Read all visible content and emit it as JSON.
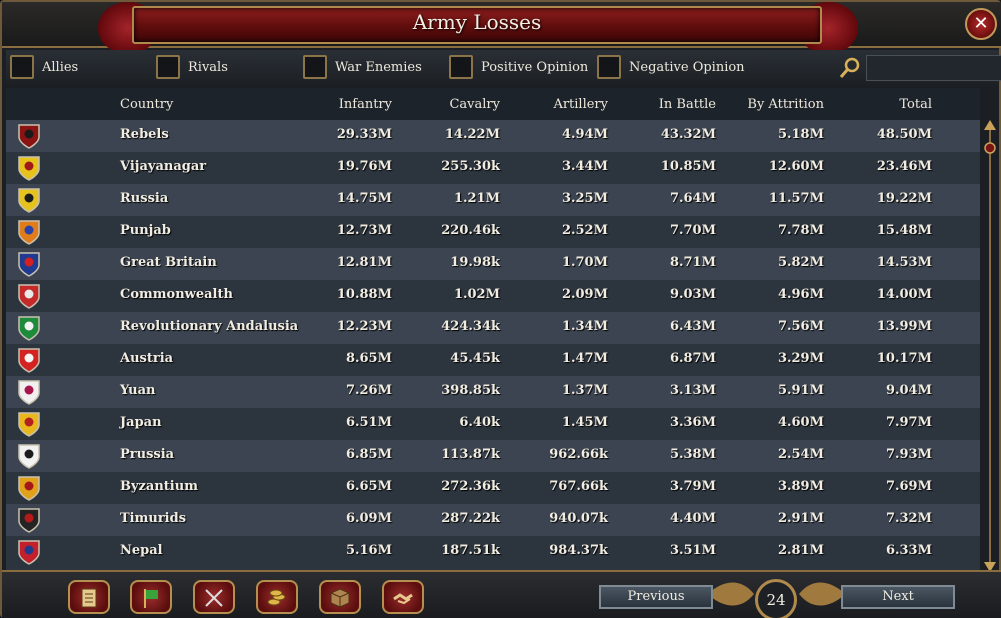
{
  "window": {
    "title": "Army Losses",
    "close_label": "✕"
  },
  "filters": [
    {
      "label": "Allies"
    },
    {
      "label": "Rivals"
    },
    {
      "label": "War Enemies"
    },
    {
      "label": "Positive Opinion"
    },
    {
      "label": "Negative Opinion"
    }
  ],
  "search": {
    "placeholder": "",
    "value": ""
  },
  "columns": [
    "Country",
    "Infantry",
    "Cavalry",
    "Artillery",
    "In Battle",
    "By Attrition",
    "Total"
  ],
  "rows": [
    {
      "country": "Rebels",
      "infantry": "29.33M",
      "cavalry": "14.22M",
      "artillery": "4.94M",
      "in_battle": "43.32M",
      "by_attrition": "5.18M",
      "total": "48.50M",
      "flag": [
        "#8a1414",
        "#1a1a1a"
      ]
    },
    {
      "country": "Vijayanagar",
      "infantry": "19.76M",
      "cavalry": "255.30k",
      "artillery": "3.44M",
      "in_battle": "10.85M",
      "by_attrition": "12.60M",
      "total": "23.46M",
      "flag": [
        "#e7c21b",
        "#a01818"
      ]
    },
    {
      "country": "Russia",
      "infantry": "14.75M",
      "cavalry": "1.21M",
      "artillery": "3.25M",
      "in_battle": "7.64M",
      "by_attrition": "11.57M",
      "total": "19.22M",
      "flag": [
        "#e6c21f",
        "#1b1b1b"
      ]
    },
    {
      "country": "Punjab",
      "infantry": "12.73M",
      "cavalry": "220.46k",
      "artillery": "2.52M",
      "in_battle": "7.70M",
      "by_attrition": "7.78M",
      "total": "15.48M",
      "flag": [
        "#e07d1a",
        "#2742a8"
      ]
    },
    {
      "country": "Great Britain",
      "infantry": "12.81M",
      "cavalry": "19.98k",
      "artillery": "1.70M",
      "in_battle": "8.71M",
      "by_attrition": "5.82M",
      "total": "14.53M",
      "flag": [
        "#1f3a8f",
        "#d52020"
      ]
    },
    {
      "country": "Commonwealth",
      "infantry": "10.88M",
      "cavalry": "1.02M",
      "artillery": "2.09M",
      "in_battle": "9.03M",
      "by_attrition": "4.96M",
      "total": "14.00M",
      "flag": [
        "#c42a2a",
        "#e9e9e9"
      ]
    },
    {
      "country": "Revolutionary Andalusia",
      "infantry": "12.23M",
      "cavalry": "424.34k",
      "artillery": "1.34M",
      "in_battle": "6.43M",
      "by_attrition": "7.56M",
      "total": "13.99M",
      "flag": [
        "#1e8a3b",
        "#f2f2f2"
      ]
    },
    {
      "country": "Austria",
      "infantry": "8.65M",
      "cavalry": "45.45k",
      "artillery": "1.47M",
      "in_battle": "6.87M",
      "by_attrition": "3.29M",
      "total": "10.17M",
      "flag": [
        "#d42222",
        "#f4f4f4"
      ]
    },
    {
      "country": "Yuan",
      "infantry": "7.26M",
      "cavalry": "398.85k",
      "artillery": "1.37M",
      "in_battle": "3.13M",
      "by_attrition": "5.91M",
      "total": "9.04M",
      "flag": [
        "#f0f0f0",
        "#a8154a"
      ]
    },
    {
      "country": "Japan",
      "infantry": "6.51M",
      "cavalry": "6.40k",
      "artillery": "1.45M",
      "in_battle": "3.36M",
      "by_attrition": "4.60M",
      "total": "7.97M",
      "flag": [
        "#e8b81e",
        "#b32020"
      ]
    },
    {
      "country": "Prussia",
      "infantry": "6.85M",
      "cavalry": "113.87k",
      "artillery": "962.66k",
      "in_battle": "5.38M",
      "by_attrition": "2.54M",
      "total": "7.93M",
      "flag": [
        "#f2f2f2",
        "#1c1c1c"
      ]
    },
    {
      "country": "Byzantium",
      "infantry": "6.65M",
      "cavalry": "272.36k",
      "artillery": "767.66k",
      "in_battle": "3.79M",
      "by_attrition": "3.89M",
      "total": "7.69M",
      "flag": [
        "#e0a21b",
        "#a61818"
      ]
    },
    {
      "country": "Timurids",
      "infantry": "6.09M",
      "cavalry": "287.22k",
      "artillery": "940.07k",
      "in_battle": "4.40M",
      "by_attrition": "2.91M",
      "total": "7.32M",
      "flag": [
        "#242424",
        "#b41a1a"
      ]
    },
    {
      "country": "Nepal",
      "infantry": "5.16M",
      "cavalry": "187.51k",
      "artillery": "984.37k",
      "in_battle": "3.51M",
      "by_attrition": "2.81M",
      "total": "6.33M",
      "flag": [
        "#c4202c",
        "#1f3b8c"
      ]
    }
  ],
  "bottom": {
    "icons": [
      "ledger-icon",
      "flag-icon",
      "crossed-swords-icon",
      "coins-icon",
      "crate-icon",
      "handshake-icon"
    ],
    "previous_label": "Previous",
    "next_label": "Next",
    "page_number": "24"
  },
  "colors": {
    "accent_red": "#7a1414",
    "gold_trim": "#b08a4c",
    "row_odd": "#3b4450",
    "row_even": "#2c343e"
  }
}
